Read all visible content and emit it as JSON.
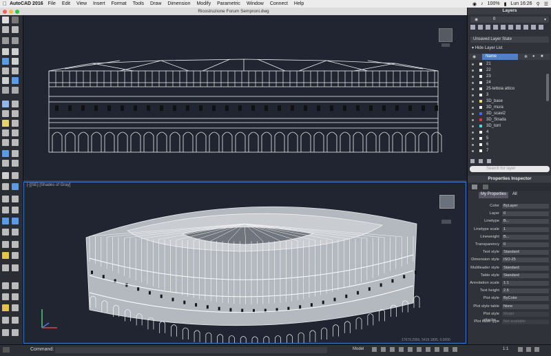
{
  "menubar": {
    "app_name": "AutoCAD 2016",
    "items": [
      "File",
      "Edit",
      "View",
      "Insert",
      "Format",
      "Tools",
      "Draw",
      "Dimension",
      "Modify",
      "Parametric",
      "Window",
      "Connect",
      "Help"
    ],
    "battery": "100%",
    "clock": "Lun 16:26"
  },
  "window": {
    "title": "Ricostruzione Forum Semproni.dwg"
  },
  "viewport_bottom": {
    "label": "[-][SE] [Shades of Gray]",
    "coords": "17679.2950, 5419.1895, 0.0000"
  },
  "layers": {
    "title": "Layers",
    "current_value": "0",
    "state": "Unsaved Layer State",
    "hide_list": "Hide Layer List",
    "name_header": "Name",
    "rows": [
      {
        "name": "21",
        "color": "#ffffff"
      },
      {
        "name": "22",
        "color": "#ffffff"
      },
      {
        "name": "23",
        "color": "#ffffff"
      },
      {
        "name": "24",
        "color": "#ffffff"
      },
      {
        "name": "25-tettoia attico",
        "color": "#ffffff"
      },
      {
        "name": "3",
        "color": "#ffffff"
      },
      {
        "name": "3D_base",
        "color": "#f0e060"
      },
      {
        "name": "3D_mura",
        "color": "#ffffff"
      },
      {
        "name": "3D_scavi2",
        "color": "#3f6fd8"
      },
      {
        "name": "3D_Strada",
        "color": "#d83a3a"
      },
      {
        "name": "3D_torri",
        "color": "#5fd1d8"
      },
      {
        "name": "4",
        "color": "#ffffff"
      },
      {
        "name": "5",
        "color": "#ffffff"
      },
      {
        "name": "6",
        "color": "#ffffff"
      },
      {
        "name": "7",
        "color": "#ffffff"
      }
    ],
    "search_placeholder": "Search for layer"
  },
  "properties": {
    "title": "Properties Inspector",
    "tab_my": "My Properties",
    "tab_all": "All",
    "rows": [
      {
        "label": "Color",
        "value": "ByLayer",
        "disabled": false
      },
      {
        "label": "Layer",
        "value": "0",
        "disabled": false
      },
      {
        "label": "Linetype",
        "value": "B...",
        "disabled": false
      },
      {
        "label": "Linetype scale",
        "value": "1",
        "disabled": false
      },
      {
        "label": "Lineweight",
        "value": "B...",
        "disabled": false
      },
      {
        "label": "Transparency",
        "value": "0",
        "disabled": false
      },
      {
        "label": "Text style",
        "value": "Standard",
        "disabled": false
      },
      {
        "label": "Dimension style",
        "value": "ISO-25",
        "disabled": false
      },
      {
        "label": "Multileader style",
        "value": "Standard",
        "disabled": false
      },
      {
        "label": "Table style",
        "value": "Standard",
        "disabled": false
      },
      {
        "label": "Annotation scale",
        "value": "1:1",
        "disabled": false
      },
      {
        "label": "Text height",
        "value": "2.5",
        "disabled": false
      },
      {
        "label": "Plot style",
        "value": "ByColor",
        "disabled": false
      },
      {
        "label": "Plot style table",
        "value": "None",
        "disabled": false
      },
      {
        "label": "Plot style attache...",
        "value": "Model",
        "disabled": true
      },
      {
        "label": "Plot table type",
        "value": "Not available",
        "disabled": true
      }
    ]
  },
  "command": {
    "label": "Command:",
    "model_tab": "Model",
    "scale": "1:1"
  },
  "colors": {
    "accent": "#3b7bd6",
    "background": "#202531"
  }
}
